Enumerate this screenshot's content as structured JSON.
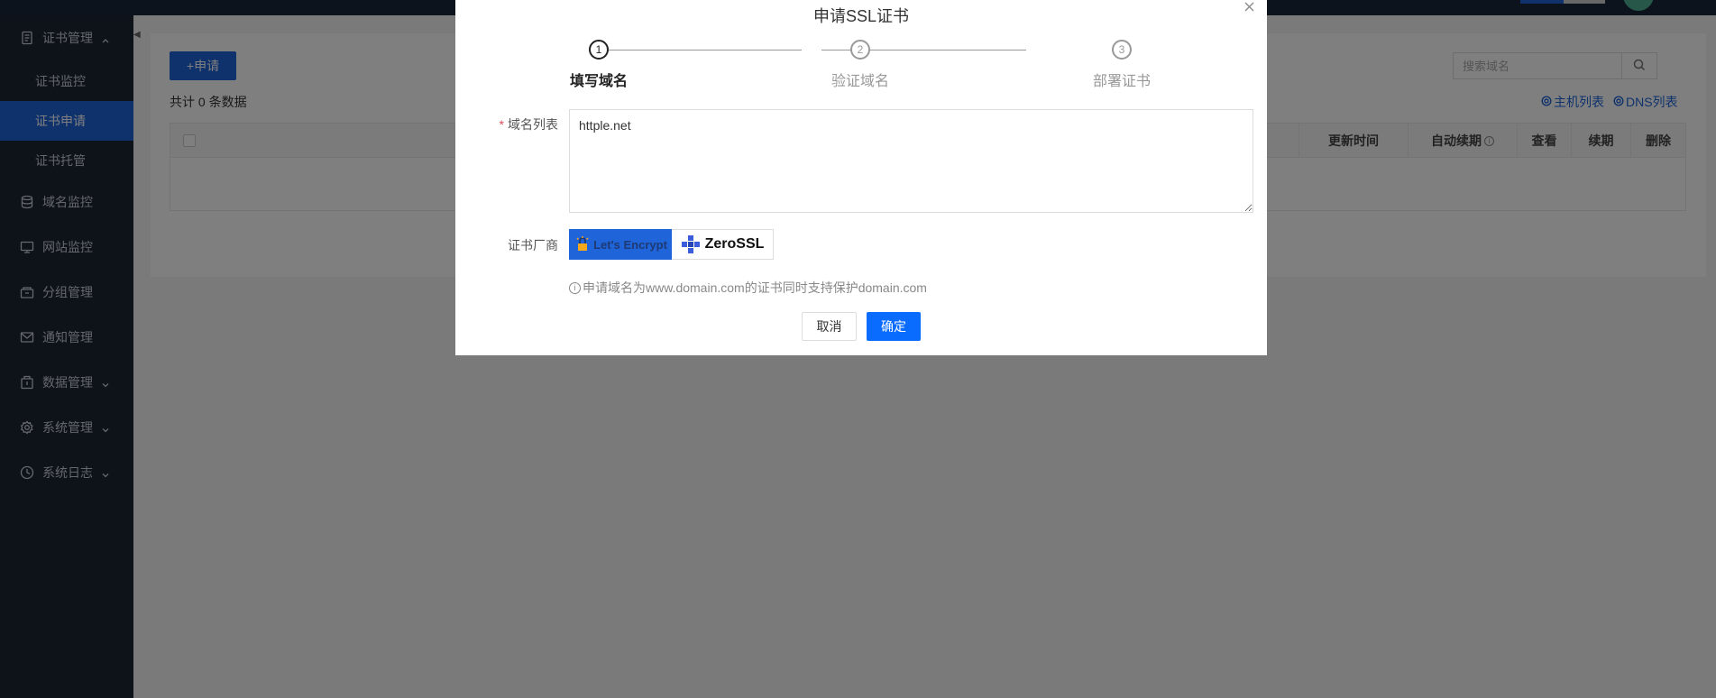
{
  "sidebar": {
    "items": [
      {
        "label": "证书管理",
        "icon": "document-icon",
        "expanded": true
      },
      {
        "label": "证书监控",
        "sub": true
      },
      {
        "label": "证书申请",
        "sub": true,
        "active": true
      },
      {
        "label": "证书托管",
        "sub": true
      },
      {
        "label": "域名监控",
        "icon": "database-icon"
      },
      {
        "label": "网站监控",
        "icon": "monitor-icon"
      },
      {
        "label": "分组管理",
        "icon": "folder-icon"
      },
      {
        "label": "通知管理",
        "icon": "mail-icon"
      },
      {
        "label": "数据管理",
        "icon": "package-icon",
        "expandable": true
      },
      {
        "label": "系统管理",
        "icon": "gear-icon",
        "expandable": true
      },
      {
        "label": "系统日志",
        "icon": "clock-icon",
        "expandable": true
      }
    ]
  },
  "main": {
    "apply_button": "+申请",
    "count_text": "共计 0 条数据",
    "search_placeholder": "搜索域名",
    "host_list_link": "主机列表",
    "dns_list_link": "DNS列表",
    "columns": [
      "更新时间",
      "自动续期",
      "查看",
      "续期",
      "删除"
    ]
  },
  "modal": {
    "title": "申请SSL证书",
    "steps": [
      {
        "num": "1",
        "label": "填写域名",
        "active": true
      },
      {
        "num": "2",
        "label": "验证域名",
        "active": false
      },
      {
        "num": "3",
        "label": "部署证书",
        "active": false
      }
    ],
    "domain_label": "域名列表",
    "domain_required_mark": "*",
    "domain_value": "httple.net",
    "vendor_label": "证书厂商",
    "vendors": [
      {
        "name": "Let's Encrypt",
        "selected": true
      },
      {
        "name": "ZeroSSL",
        "selected": false
      }
    ],
    "tip_icon": "i",
    "tip": "申请域名为www.domain.com的证书同时支持保护domain.com",
    "cancel_label": "取消",
    "ok_label": "确定"
  },
  "colors": {
    "primary": "#1f64d8",
    "confirm": "#0a6cff",
    "sidebar_bg": "#1d2634"
  }
}
